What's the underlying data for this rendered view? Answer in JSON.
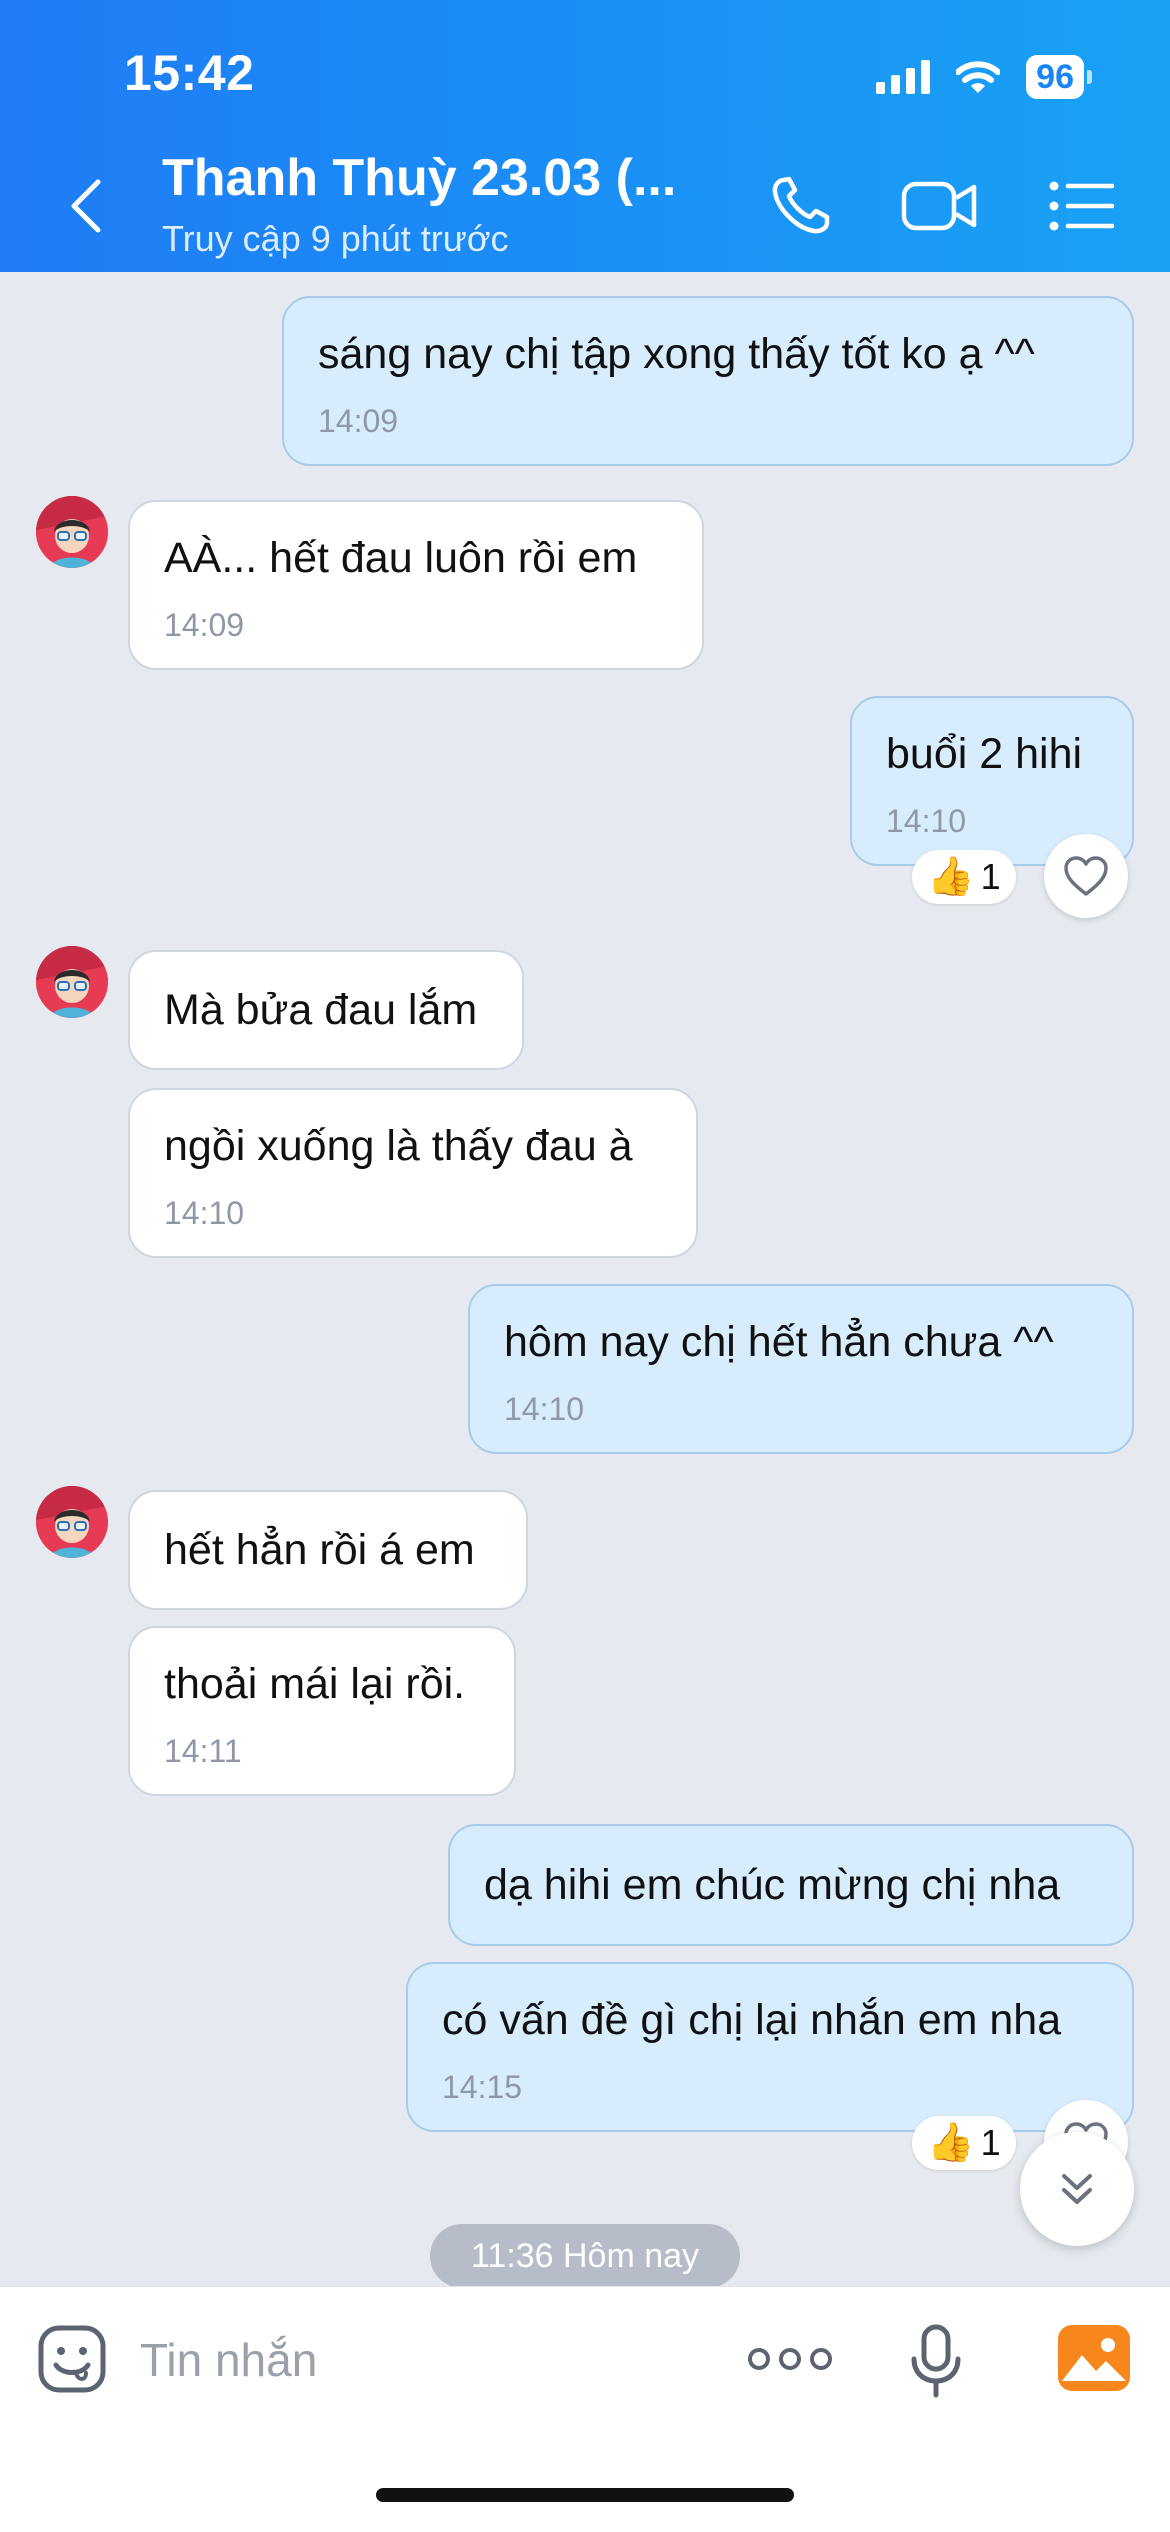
{
  "status_bar": {
    "time": "15:42",
    "battery": "96"
  },
  "header": {
    "name": "Thanh Thuỳ 23.03 (...",
    "status": "Truy cập 9 phút trước"
  },
  "messages": [
    {
      "text": "sáng nay chị tập xong thấy tốt ko ạ ^^",
      "time": "14:09"
    },
    {
      "text": "AÀ... hết đau luôn rồi em",
      "time": "14:09"
    },
    {
      "text": "buổi 2 hihi",
      "time": "14:10",
      "reaction_count": "1"
    },
    {
      "text": "Mà bửa đau lắm"
    },
    {
      "text": "ngồi xuống là thấy đau à",
      "time": "14:10"
    },
    {
      "text": "hôm nay chị hết hẳn chưa ^^",
      "time": "14:10"
    },
    {
      "text": "hết hẳn rồi á em"
    },
    {
      "text": "thoải mái lại rồi.",
      "time": "14:11"
    },
    {
      "text": "dạ hihi em chúc mừng chị nha"
    },
    {
      "text": "có vấn đề gì chị lại nhắn em nha",
      "time": "14:15",
      "reaction_count": "1"
    }
  ],
  "date_chip": "11:36 Hôm nay",
  "composer": {
    "placeholder": "Tin nhắn"
  },
  "colors": {
    "header_gradient_start": "#1f7cf5",
    "header_gradient_end": "#19a2f4",
    "outgoing_bubble": "#d7edfd",
    "incoming_bubble": "#ffffff",
    "photo_icon": "#f7871c"
  }
}
